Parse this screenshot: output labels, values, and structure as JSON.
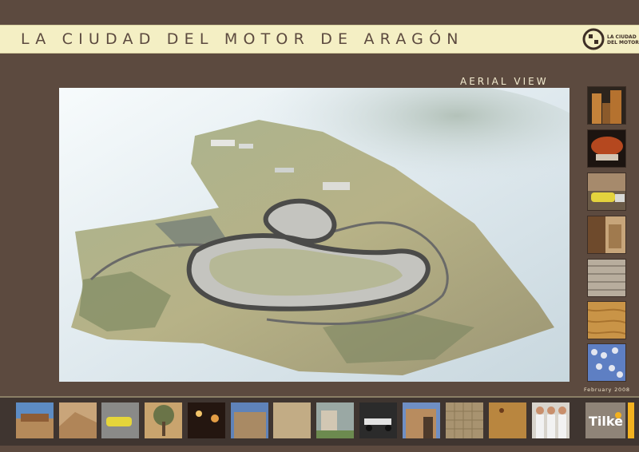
{
  "header": {
    "title": "LA CIUDAD DEL MOTOR DE ARAGÓN",
    "logo_text": "LA CIUDAD DEL MOTOR"
  },
  "main": {
    "section_heading": "AERIAL VIEW",
    "date": "February 2008"
  },
  "footer": {
    "brand": "Tilke"
  },
  "colors": {
    "background": "#5c4a3f",
    "title_band": "#f4efc4",
    "accent": "#f2b120"
  }
}
